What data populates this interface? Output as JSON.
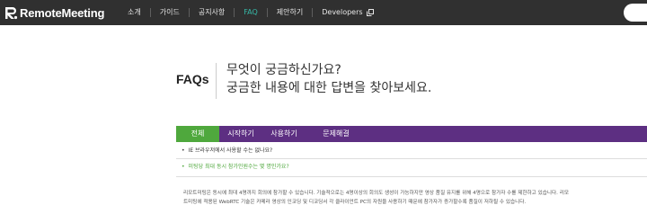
{
  "nav": {
    "logo_text": "RemoteMeeting",
    "items": [
      {
        "label": "소개",
        "active": false
      },
      {
        "label": "가이드",
        "active": false
      },
      {
        "label": "공지사항",
        "active": false
      },
      {
        "label": "FAQ",
        "active": true
      },
      {
        "label": "제안하기",
        "active": false
      },
      {
        "label": "Developers",
        "active": false
      }
    ],
    "active_color": "#36b9a8",
    "background": "#303030"
  },
  "header": {
    "label": "FAQs",
    "line1": "무엇이 궁금하신가요?",
    "line2": "궁금한 내용에 대한 답변을 찾아보세요."
  },
  "tabs": [
    {
      "label": "전체",
      "active": true
    },
    {
      "label": "시작하기",
      "active": false
    },
    {
      "label": "사용하기",
      "active": false
    },
    {
      "label": "문제해결",
      "active": false
    }
  ],
  "tab_colors": {
    "bar": "#5d2f82",
    "active": "#4fa83d"
  },
  "faqs": [
    {
      "question": "IE 브라우저에서 사용할 수는 없나요?",
      "expanded": false
    },
    {
      "question": "미팅당 최대 동시 참가인원수는 몇 명인가요?",
      "expanded": true
    }
  ],
  "answer": {
    "line1": "리모트미팅은 동시에 최대 4명까지 회의에 참가할 수 있습니다. 기술적으로는 4명이상의 회의도 생성이 가능하지만 영상 품질 유지를 위해 4명으로 참가자 수를 제한하고 있습니다. 리모",
    "line2": "트미팅에 적용된 WebRTC 기술은 카메라 영상의 인코딩 및 디코딩서 각 클라이언트 PC의 자원을 사용하기 때문에 참가자가 증가할수록 품질이 저하될 수 있습니다."
  }
}
